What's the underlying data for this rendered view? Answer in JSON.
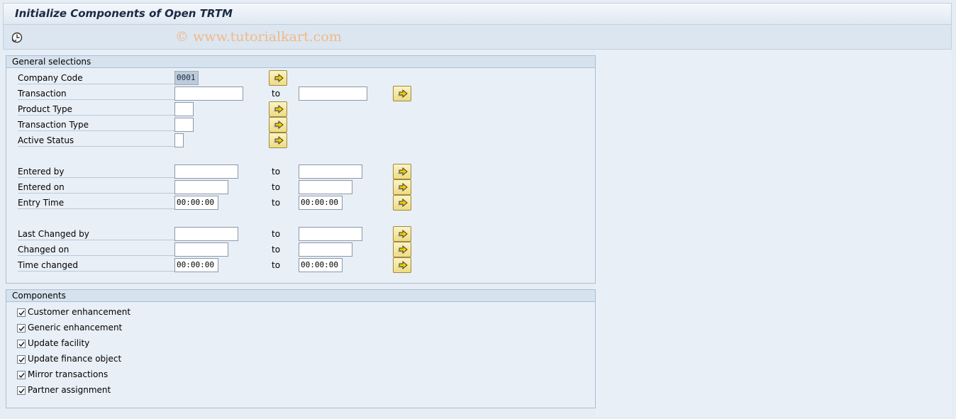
{
  "window": {
    "title": "Initialize Components of Open TRTM"
  },
  "watermark": "© www.tutorialkart.com",
  "toolbar": {
    "execute_icon": "execute-clock-icon"
  },
  "general": {
    "header": "General selections",
    "to_label": "to",
    "rows": {
      "company_code": {
        "label": "Company Code",
        "low": "0001"
      },
      "transaction": {
        "label": "Transaction",
        "low": "",
        "high": ""
      },
      "product_type": {
        "label": "Product Type",
        "low": ""
      },
      "transaction_type": {
        "label": "Transaction Type",
        "low": ""
      },
      "active_status": {
        "label": "Active Status",
        "low": ""
      },
      "entered_by": {
        "label": "Entered by",
        "low": "",
        "high": ""
      },
      "entered_on": {
        "label": "Entered on",
        "low": "",
        "high": ""
      },
      "entry_time": {
        "label": "Entry Time",
        "low": "00:00:00",
        "high": "00:00:00"
      },
      "last_changed_by": {
        "label": "Last Changed by",
        "low": "",
        "high": ""
      },
      "changed_on": {
        "label": "Changed on",
        "low": "",
        "high": ""
      },
      "time_changed": {
        "label": "Time changed",
        "low": "00:00:00",
        "high": "00:00:00"
      }
    }
  },
  "components": {
    "header": "Components",
    "items": [
      {
        "label": "Customer enhancement",
        "checked": true
      },
      {
        "label": "Generic enhancement",
        "checked": true
      },
      {
        "label": "Update facility",
        "checked": true
      },
      {
        "label": "Update finance object",
        "checked": true
      },
      {
        "label": "Mirror transactions",
        "checked": true
      },
      {
        "label": "Partner assignment",
        "checked": true
      }
    ]
  },
  "colors": {
    "button": "#eedc80",
    "arrow": "#e8c200",
    "header_bg": "#d6e2ee"
  }
}
